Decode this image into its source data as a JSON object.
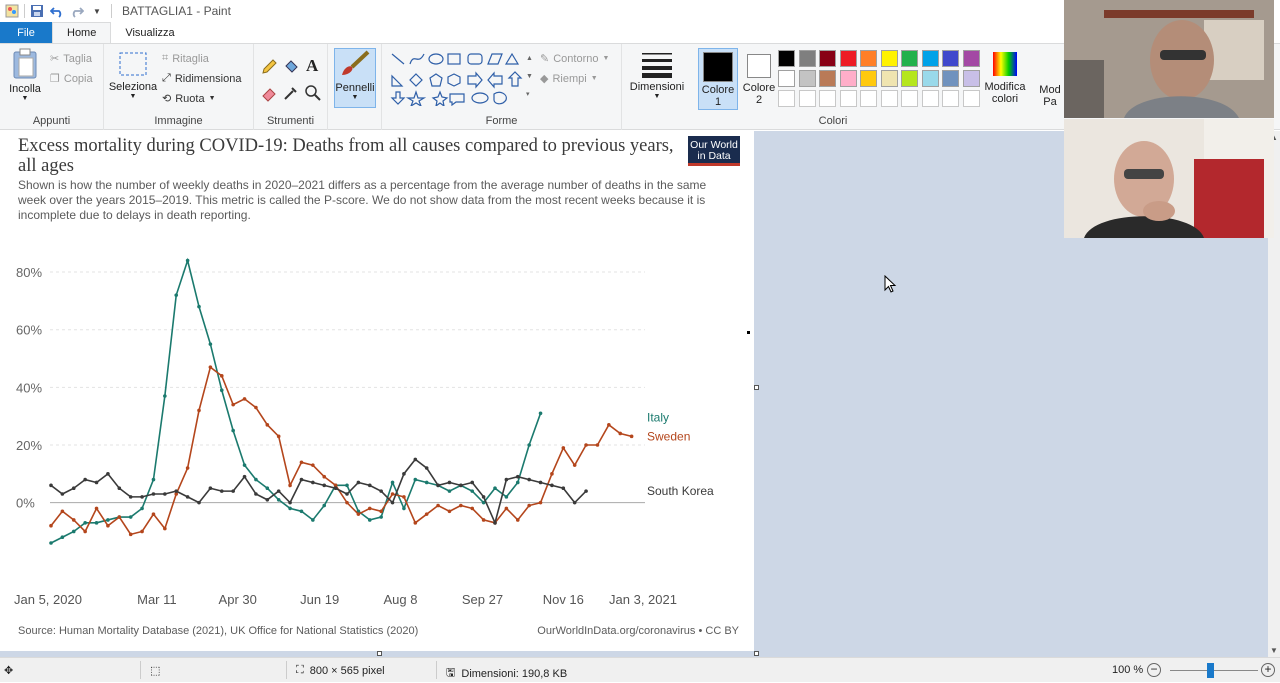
{
  "window": {
    "title": "BATTAGLIA1 - Paint"
  },
  "tabs": {
    "file": "File",
    "home": "Home",
    "view": "Visualizza"
  },
  "ribbon": {
    "clipboard": {
      "paste": "Incolla",
      "cut": "Taglia",
      "copy": "Copia",
      "label": "Appunti"
    },
    "image": {
      "select": "Seleziona",
      "crop": "Ritaglia",
      "resize": "Ridimensiona",
      "rotate": "Ruota",
      "label": "Immagine"
    },
    "tools": {
      "label": "Strumenti"
    },
    "brushes": {
      "label": "Pennelli"
    },
    "shapes": {
      "outline": "Contorno",
      "fill": "Riempi",
      "label": "Forme"
    },
    "size": {
      "label": "Dimensioni"
    },
    "colors": {
      "color1": "Colore 1",
      "color2": "Colore 2",
      "edit": "Modifica colori",
      "paint3d": "Mod Pa",
      "label": "Colori",
      "palette_row1": [
        "#000000",
        "#7f7f7f",
        "#880015",
        "#ed1c24",
        "#ff7f27",
        "#fff200",
        "#22b14c",
        "#00a2e8",
        "#3f48cc",
        "#a349a4"
      ],
      "palette_row2": [
        "#ffffff",
        "#c3c3c3",
        "#b97a57",
        "#ffaec9",
        "#ffc90e",
        "#efe4b0",
        "#b5e61d",
        "#99d9ea",
        "#7092be",
        "#c8bfe7"
      ]
    }
  },
  "chart": {
    "title": "Excess mortality during COVID-19: Deaths from all causes compared to previous years, all ages",
    "subtitle": "Shown is how the number of weekly deaths in 2020–2021 differs as a percentage from the average number of deaths in the same week over the years 2015–2019. This metric is called the P-score. We do not show data from the most recent weeks because it is incomplete due to delays in death reporting.",
    "logo_line1": "Our World",
    "logo_line2": "in Data",
    "source": "Source: Human Mortality Database (2021), UK Office for National Statistics (2020)",
    "credit": "OurWorldInData.org/coronavirus • CC BY"
  },
  "chart_data": {
    "type": "line",
    "yticks": [
      "0%",
      "20%",
      "40%",
      "60%",
      "80%"
    ],
    "ylim": [
      -14,
      88
    ],
    "xticks": [
      {
        "label": "Jan 5, 2020",
        "week": 0
      },
      {
        "label": "Mar 11",
        "week": 9.3
      },
      {
        "label": "Apr 30",
        "week": 16.4
      },
      {
        "label": "Jun 19",
        "week": 23.6
      },
      {
        "label": "Aug 8",
        "week": 30.7
      },
      {
        "label": "Sep 27",
        "week": 37.9
      },
      {
        "label": "Nov 16",
        "week": 45
      },
      {
        "label": "Jan 3, 2021",
        "week": 52
      }
    ],
    "xlim": [
      0,
      52
    ],
    "series": [
      {
        "name": "Italy",
        "color": "#1b7a6e",
        "values": [
          [
            0,
            -14
          ],
          [
            1,
            -12
          ],
          [
            2,
            -10
          ],
          [
            3,
            -7
          ],
          [
            4,
            -7
          ],
          [
            5,
            -6
          ],
          [
            6,
            -5
          ],
          [
            7,
            -5
          ],
          [
            8,
            -2
          ],
          [
            9,
            8
          ],
          [
            10,
            37
          ],
          [
            11,
            72
          ],
          [
            12,
            84
          ],
          [
            13,
            68
          ],
          [
            14,
            55
          ],
          [
            15,
            39
          ],
          [
            16,
            25
          ],
          [
            17,
            13
          ],
          [
            18,
            8
          ],
          [
            19,
            5
          ],
          [
            20,
            1
          ],
          [
            21,
            -2
          ],
          [
            22,
            -3
          ],
          [
            23,
            -6
          ],
          [
            24,
            -1
          ],
          [
            25,
            6
          ],
          [
            26,
            6
          ],
          [
            27,
            -3
          ],
          [
            28,
            -6
          ],
          [
            29,
            -5
          ],
          [
            30,
            7
          ],
          [
            31,
            -2
          ],
          [
            32,
            8
          ],
          [
            33,
            7
          ],
          [
            34,
            6
          ],
          [
            35,
            4
          ],
          [
            36,
            6
          ],
          [
            37,
            4
          ],
          [
            38,
            0
          ],
          [
            39,
            5
          ],
          [
            40,
            2
          ],
          [
            41,
            7
          ],
          [
            42,
            20
          ],
          [
            43,
            31
          ]
        ]
      },
      {
        "name": "Sweden",
        "color": "#b4461c",
        "values": [
          [
            0,
            -8
          ],
          [
            1,
            -3
          ],
          [
            2,
            -6
          ],
          [
            3,
            -10
          ],
          [
            4,
            -2
          ],
          [
            5,
            -8
          ],
          [
            6,
            -5
          ],
          [
            7,
            -11
          ],
          [
            8,
            -10
          ],
          [
            9,
            -4
          ],
          [
            10,
            -9
          ],
          [
            11,
            3
          ],
          [
            12,
            12
          ],
          [
            13,
            32
          ],
          [
            14,
            47
          ],
          [
            15,
            44
          ],
          [
            16,
            34
          ],
          [
            17,
            36
          ],
          [
            18,
            33
          ],
          [
            19,
            27
          ],
          [
            20,
            23
          ],
          [
            21,
            6
          ],
          [
            22,
            14
          ],
          [
            23,
            13
          ],
          [
            24,
            9
          ],
          [
            25,
            6
          ],
          [
            26,
            0
          ],
          [
            27,
            -4
          ],
          [
            28,
            -2
          ],
          [
            29,
            -3
          ],
          [
            30,
            3
          ],
          [
            31,
            2
          ],
          [
            32,
            -7
          ],
          [
            33,
            -4
          ],
          [
            34,
            -1
          ],
          [
            35,
            -3
          ],
          [
            36,
            -1
          ],
          [
            37,
            -2
          ],
          [
            38,
            -6
          ],
          [
            39,
            -7
          ],
          [
            40,
            -2
          ],
          [
            41,
            -6
          ],
          [
            42,
            -1
          ],
          [
            43,
            0
          ],
          [
            44,
            10
          ],
          [
            45,
            19
          ],
          [
            46,
            13
          ],
          [
            47,
            20
          ],
          [
            48,
            20
          ],
          [
            49,
            27
          ],
          [
            50,
            24
          ],
          [
            51,
            23
          ]
        ]
      },
      {
        "name": "South Korea",
        "color": "#3a3a3a",
        "values": [
          [
            0,
            6
          ],
          [
            1,
            3
          ],
          [
            2,
            5
          ],
          [
            3,
            8
          ],
          [
            4,
            7
          ],
          [
            5,
            10
          ],
          [
            6,
            5
          ],
          [
            7,
            2
          ],
          [
            8,
            2
          ],
          [
            9,
            3
          ],
          [
            10,
            3
          ],
          [
            11,
            4
          ],
          [
            12,
            2
          ],
          [
            13,
            0
          ],
          [
            14,
            5
          ],
          [
            15,
            4
          ],
          [
            16,
            4
          ],
          [
            17,
            9
          ],
          [
            18,
            3
          ],
          [
            19,
            1
          ],
          [
            20,
            4
          ],
          [
            21,
            0
          ],
          [
            22,
            8
          ],
          [
            23,
            7
          ],
          [
            24,
            6
          ],
          [
            25,
            5
          ],
          [
            26,
            3
          ],
          [
            27,
            7
          ],
          [
            28,
            6
          ],
          [
            29,
            4
          ],
          [
            30,
            0
          ],
          [
            31,
            10
          ],
          [
            32,
            15
          ],
          [
            33,
            12
          ],
          [
            34,
            6
          ],
          [
            35,
            7
          ],
          [
            36,
            6
          ],
          [
            37,
            7
          ],
          [
            38,
            2
          ],
          [
            39,
            -7
          ],
          [
            40,
            8
          ],
          [
            41,
            9
          ],
          [
            42,
            8
          ],
          [
            43,
            7
          ],
          [
            44,
            6
          ],
          [
            45,
            5
          ],
          [
            46,
            0
          ],
          [
            47,
            4
          ]
        ]
      }
    ]
  },
  "status": {
    "dimensions": "800 × 565 pixel",
    "size": "Dimensioni: 190,8 KB",
    "zoom": "100 %"
  }
}
